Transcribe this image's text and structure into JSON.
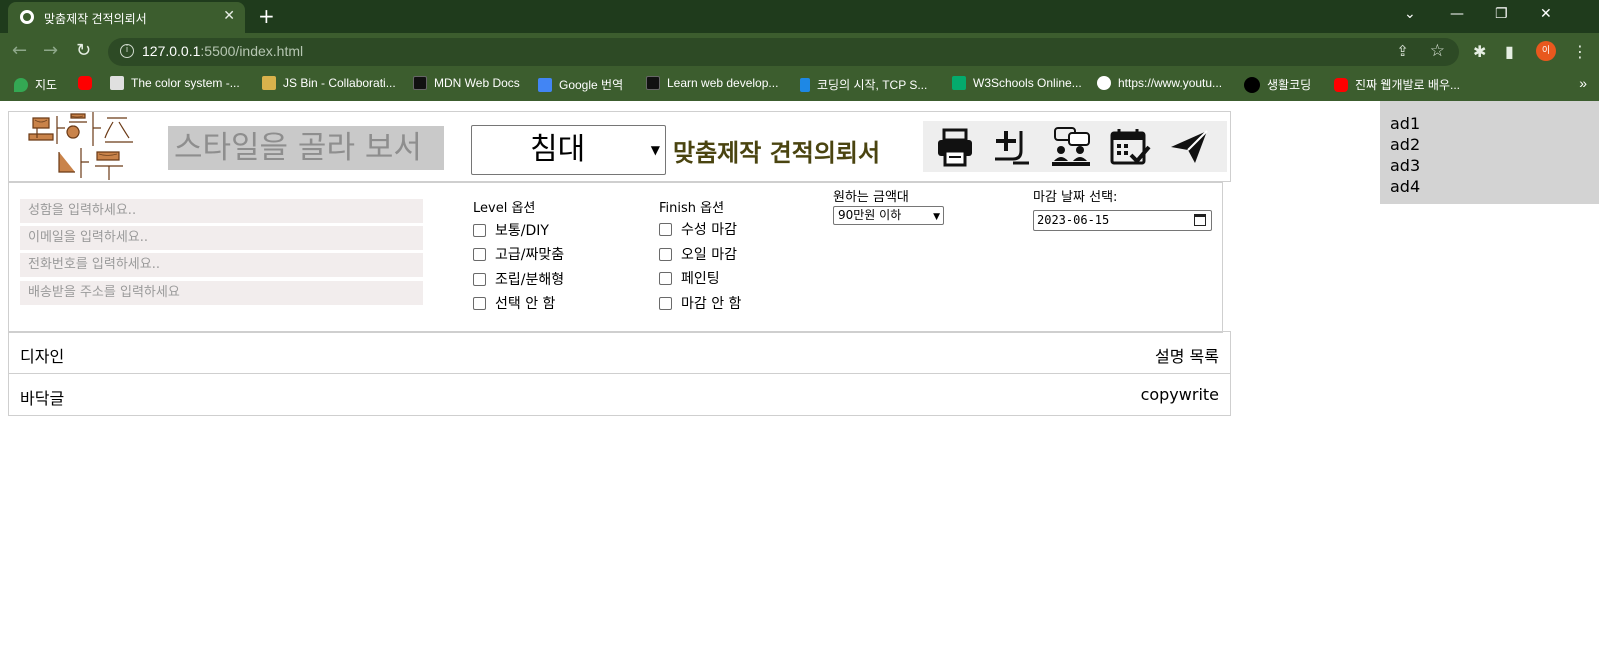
{
  "browser": {
    "tab_title": "맞춤제작 견적의뢰서",
    "tab_close": "✕",
    "new_tab": "+",
    "window_controls": [
      "⌄",
      "—",
      "❐",
      "✕"
    ],
    "url_host": "127.0.0.1",
    "url_path": ":5500/index.html",
    "profile_initial": "이",
    "bookmarks": [
      {
        "label": "지도",
        "icon": "maps-icon",
        "color": "#34a853"
      },
      {
        "label": "",
        "icon": "youtube-icon",
        "color": "#ff0000"
      },
      {
        "label": "The color system -...",
        "icon": "page-icon",
        "color": "#e0e0e0"
      },
      {
        "label": "JS Bin - Collaborati...",
        "icon": "jsbin-icon",
        "color": "#d9b24c"
      },
      {
        "label": "MDN Web Docs",
        "icon": "mdn-icon",
        "color": "#111111"
      },
      {
        "label": "Google 번역",
        "icon": "translate-icon",
        "color": "#4285f4"
      },
      {
        "label": "Learn web develop...",
        "icon": "mdn-icon",
        "color": "#111111"
      },
      {
        "label": "코딩의 시작, TCP S...",
        "icon": "tcp-icon",
        "color": "#1e88e5"
      },
      {
        "label": "W3Schools Online...",
        "icon": "w3schools-icon",
        "color": "#04aa6d"
      },
      {
        "label": "https://www.youtu...",
        "icon": "globe-icon",
        "color": "#ffffff"
      },
      {
        "label": "생활코딩",
        "icon": "circle-icon",
        "color": "#000000"
      },
      {
        "label": "진짜 웹개발로 배우...",
        "icon": "youtube-icon",
        "color": "#ff0000"
      }
    ],
    "more": "»"
  },
  "header": {
    "style_placeholder": "스타일을 골라 보서",
    "furniture_select": "침대",
    "title": "맞춤제작 견적의뢰서",
    "icons": [
      "printer-icon",
      "add-edit-icon",
      "meeting-icon",
      "calendar-check-icon",
      "send-icon"
    ]
  },
  "ads": [
    "ad1",
    "ad2",
    "ad3",
    "ad4"
  ],
  "form": {
    "name_placeholder": "성함을 입력하세요..",
    "email_placeholder": "이메일을 입력하세요..",
    "phone_placeholder": "전화번호를 입력하세요..",
    "address_placeholder": "배송받을 주소를 입력하세요",
    "level_title": "Level 옵션",
    "level_options": [
      "보통/DIY",
      "고급/짜맞춤",
      "조립/분해형",
      "선택 안 함"
    ],
    "finish_title": "Finish 옵션",
    "finish_options": [
      "수성 마감",
      "오일 마감",
      "페인팅",
      "마감 안 함"
    ],
    "price_title": "원하는 금액대",
    "price_selected": "90만원 이하",
    "date_title": "마감 날짜 선택:",
    "date_value": "2023-06-15"
  },
  "design_band": {
    "left": "디자인",
    "right": "설명 목록"
  },
  "footer": {
    "left": "바닥글",
    "right": "copywrite"
  },
  "colors": {
    "title": "#4a4410",
    "chrome_dark": "#1f3b1c",
    "chrome": "#3c5d2e",
    "ad_bg": "#d3d3d3",
    "field_bg": "#f2eded"
  }
}
